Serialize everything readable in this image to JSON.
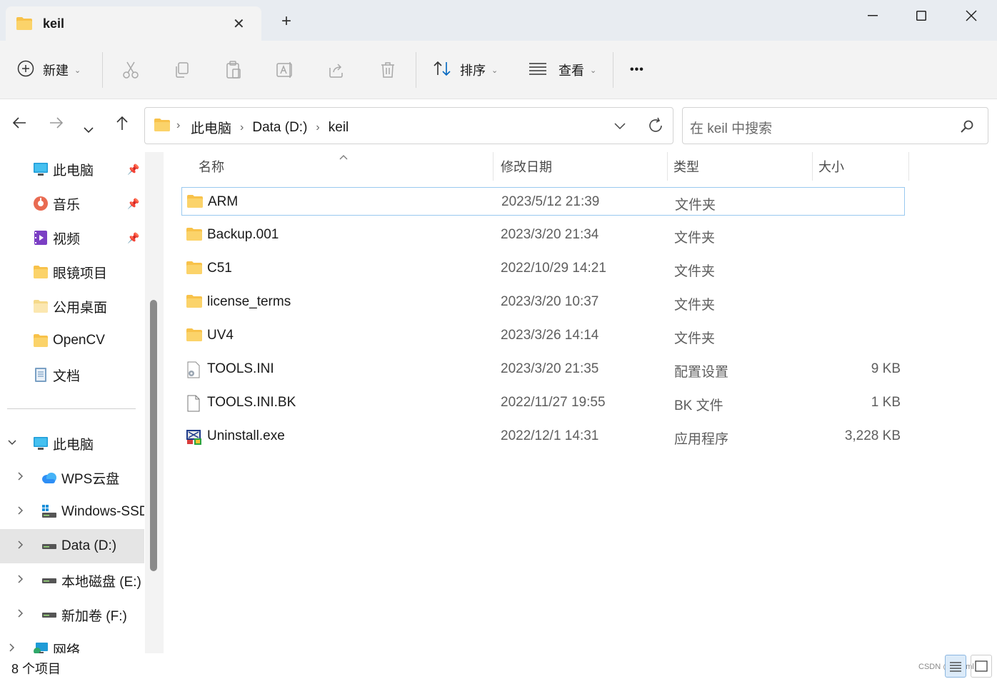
{
  "window": {
    "tab_title": "keil",
    "close_tab": "✕",
    "new_tab": "+",
    "minimize": "—",
    "maximize": "☐",
    "close": "✕"
  },
  "toolbar": {
    "new_label": "新建",
    "sort_label": "排序",
    "view_label": "查看",
    "more": "•••"
  },
  "address": {
    "crumbs": [
      "此电脑",
      "Data (D:)",
      "keil"
    ],
    "search_placeholder": "在 keil 中搜索"
  },
  "sidebar": {
    "quick": [
      {
        "label": "此电脑",
        "icon": "monitor-icon",
        "pinned": true
      },
      {
        "label": "音乐",
        "icon": "music-icon",
        "pinned": true
      },
      {
        "label": "视频",
        "icon": "video-icon",
        "pinned": true
      },
      {
        "label": "眼镜项目",
        "icon": "folder-icon",
        "pinned": false
      },
      {
        "label": "公用桌面",
        "icon": "folder-icon",
        "pinned": false
      },
      {
        "label": "OpenCV",
        "icon": "folder-icon",
        "pinned": false
      },
      {
        "label": "文档",
        "icon": "document-icon",
        "pinned": false
      }
    ],
    "tree": [
      {
        "label": "此电脑",
        "icon": "monitor-icon",
        "expanded": true
      },
      {
        "label": "WPS云盘",
        "icon": "cloud-icon"
      },
      {
        "label": "Windows-SSD",
        "icon": "windows-drive-icon"
      },
      {
        "label": "Data (D:)",
        "icon": "drive-icon",
        "selected": true
      },
      {
        "label": "本地磁盘 (E:)",
        "icon": "drive-icon"
      },
      {
        "label": "新加卷 (F:)",
        "icon": "drive-icon"
      },
      {
        "label": "网络",
        "icon": "network-icon"
      }
    ]
  },
  "columns": {
    "name": "名称",
    "modified": "修改日期",
    "type": "类型",
    "size": "大小"
  },
  "files": [
    {
      "name": "ARM",
      "modified": "2023/5/12 21:39",
      "type": "文件夹",
      "size": "",
      "icon": "folder-icon"
    },
    {
      "name": "Backup.001",
      "modified": "2023/3/20 21:34",
      "type": "文件夹",
      "size": "",
      "icon": "folder-icon"
    },
    {
      "name": "C51",
      "modified": "2022/10/29 14:21",
      "type": "文件夹",
      "size": "",
      "icon": "folder-icon"
    },
    {
      "name": "license_terms",
      "modified": "2023/3/20 10:37",
      "type": "文件夹",
      "size": "",
      "icon": "folder-icon"
    },
    {
      "name": "UV4",
      "modified": "2023/3/26 14:14",
      "type": "文件夹",
      "size": "",
      "icon": "folder-icon"
    },
    {
      "name": "TOOLS.INI",
      "modified": "2023/3/20 21:35",
      "type": "配置设置",
      "size": "9 KB",
      "icon": "settings-file-icon"
    },
    {
      "name": "TOOLS.INI.BK",
      "modified": "2022/11/27 19:55",
      "type": "BK 文件",
      "size": "1 KB",
      "icon": "file-icon"
    },
    {
      "name": "Uninstall.exe",
      "modified": "2022/12/1 14:31",
      "type": "应用程序",
      "size": "3,228 KB",
      "icon": "exe-icon"
    }
  ],
  "status": {
    "count": "8 个项目",
    "watermark": "CSDN @qq_lml"
  },
  "colors": {
    "accent": "#0067c0",
    "folder": "#f8c24a",
    "selection_border": "#99c9ef"
  }
}
